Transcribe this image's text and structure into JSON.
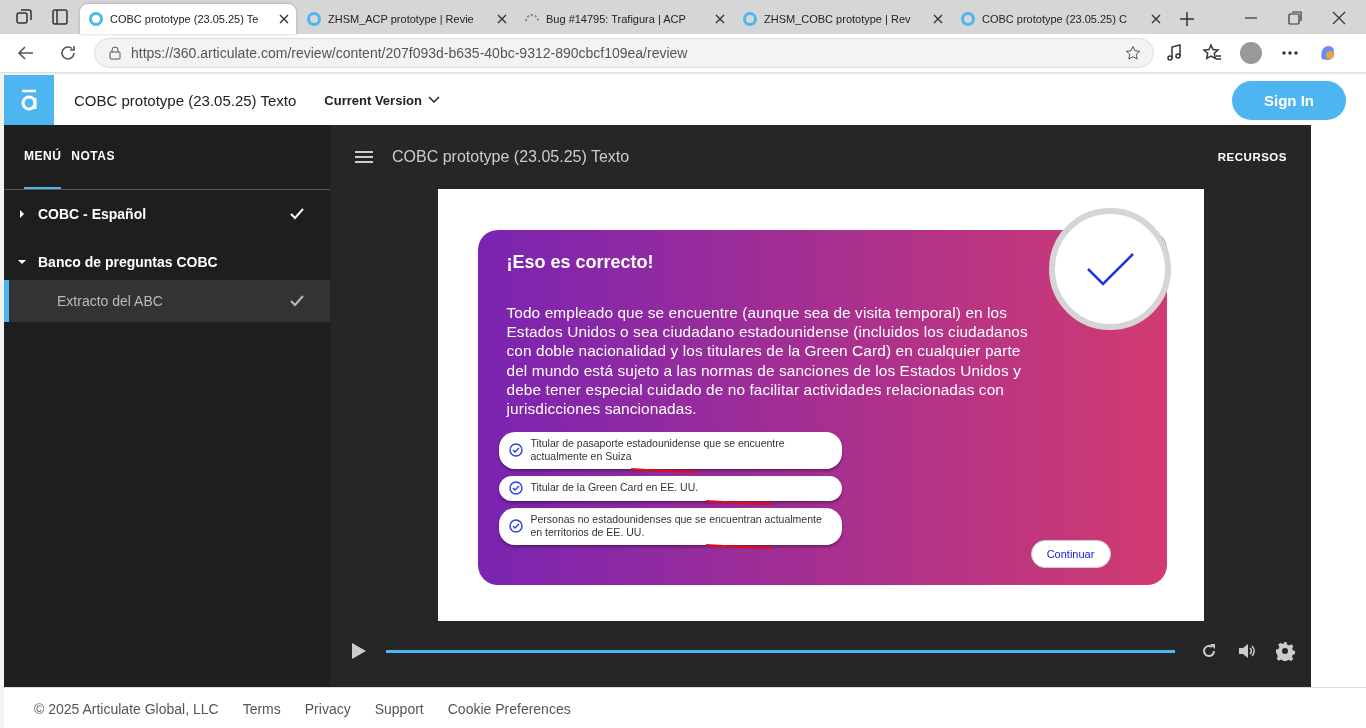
{
  "browser": {
    "tabs": [
      {
        "title": "COBC prototype (23.05.25) Te",
        "selected": true,
        "kind": "ring"
      },
      {
        "title": "ZHSM_ACP prototype | Revie",
        "selected": false,
        "kind": "ring"
      },
      {
        "title": "Bug #14795: Trafigura | ACP",
        "selected": false,
        "kind": "loading"
      },
      {
        "title": "ZHSM_COBC prototype | Rev",
        "selected": false,
        "kind": "ring"
      },
      {
        "title": "COBC prototype (23.05.25) C",
        "selected": false,
        "kind": "ring"
      }
    ],
    "url": "https://360.articulate.com/review/content/207f093d-b635-40bc-9312-890cbcf109ea/review"
  },
  "header": {
    "title": "COBC prototype (23.05.25) Texto",
    "version": "Current Version",
    "sign_in": "Sign In"
  },
  "sidebar": {
    "tabs": [
      {
        "label": "MENÚ",
        "selected": true
      },
      {
        "label": "NOTAS",
        "selected": false
      }
    ],
    "items": [
      {
        "label": "COBC - Español",
        "expanded": false,
        "completed": true
      },
      {
        "label": "Banco de preguntas COBC",
        "expanded": true,
        "completed": false,
        "children": [
          {
            "label": "Extracto del ABC",
            "selected": true,
            "completed": true
          }
        ]
      }
    ]
  },
  "player": {
    "title": "COBC prototype (23.05.25) Texto",
    "resources": "RECURSOS",
    "slide": {
      "heading": "¡Eso es correcto!",
      "body": "Todo empleado que se encuentre (aunque sea de visita temporal) en los Estados Unidos o sea ciudadano estadounidense (incluidos los ciudadanos con doble nacionalidad y los titulares de la Green Card) en cualquier parte del mundo está sujeto a las normas de sanciones de los Estados Unidos y debe tener especial cuidado de no facilitar actividades relacionadas con jurisdicciones sancionadas.",
      "options": [
        {
          "text": "Titular de pasaporte estadounidense que se encuentre actualmente en Suiza",
          "checked": true,
          "underlined": true
        },
        {
          "text": "Titular de la Green Card en EE. UU.",
          "checked": true,
          "underlined": true
        },
        {
          "text": "Personas no estadounidenses que se encuentran actualmente en territorios de EE. UU.",
          "checked": true,
          "underlined": true
        }
      ],
      "continue": "Continuar"
    },
    "progress": {
      "level": 1.0
    }
  },
  "footer": {
    "copyright": "© 2025 Articulate Global, LLC",
    "links": [
      "Terms",
      "Privacy",
      "Support",
      "Cookie Preferences"
    ]
  }
}
